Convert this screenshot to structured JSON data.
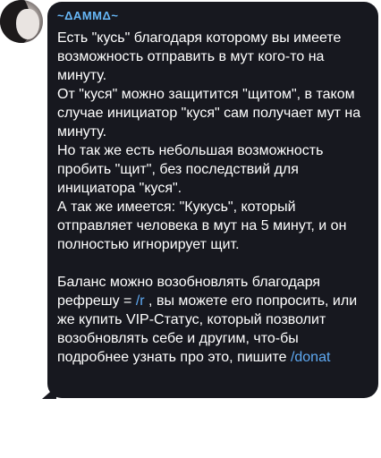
{
  "sender": {
    "name": "~ΔAMMΔ~"
  },
  "message": {
    "p1": "Есть \"кусь\" благодаря которому вы имеете возможность отправить в мут кого-то на минуту.",
    "p2": "От \"куся\" можно защитится \"щитом\", в таком случае инициатор \"куся\" сам получает мут на минуту.",
    "p3": "Но так же есть небольшая возможность пробить \"щит\", без последствий для инициатора \"куся\".",
    "p4": "А так же имеется: \"Кукусь\", который отправляет человека в мут на 5 минут, и он полностью игнорирует щит.",
    "p5_part1": "Баланс можно возобновлять благодаря рефрешу = ",
    "p5_link1": "/r",
    "p5_part2": " , вы можете его попросить, или же купить VIP-Статус, который позволит возобновлять себе и другим, что-бы подробнее узнать про это, пишите ",
    "p5_link2": "/donat"
  },
  "colors": {
    "bubble": "#17181f",
    "sender": "#67b7f7",
    "link": "#5ea9f2",
    "text": "#ffffff"
  },
  "icons": {
    "avatar": "user-avatar-photo"
  }
}
